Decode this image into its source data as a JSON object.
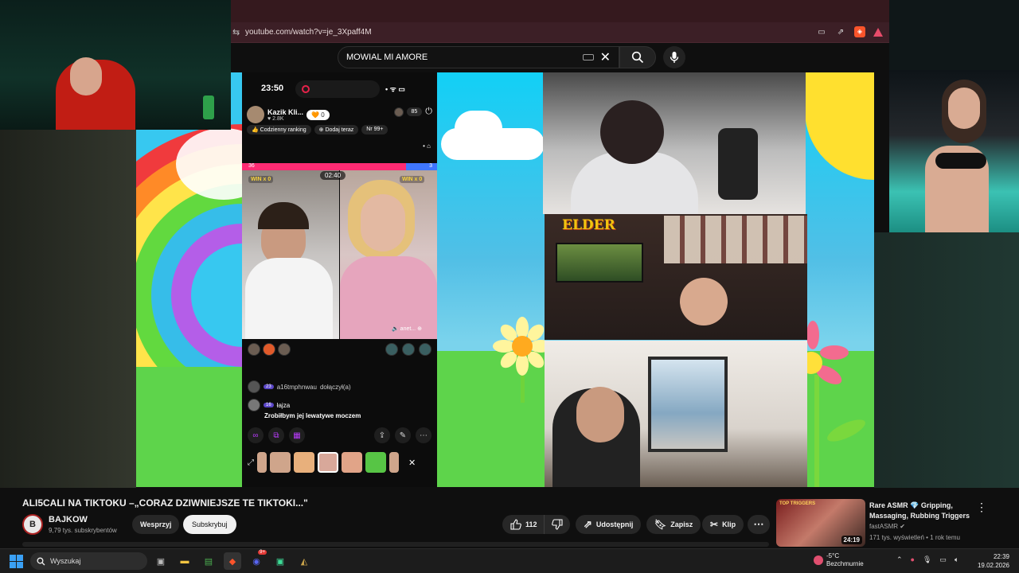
{
  "browser": {
    "url": "youtube.com/watch?v=je_3Xpaff4M"
  },
  "search": {
    "query": "MOWIAL MI AMORE"
  },
  "tiktok": {
    "time": "23:50",
    "streamer_name": "Kazik Kli...",
    "likes": "2.8K",
    "follow_count": "0",
    "viewers": "85",
    "daily_ranking": "Codzienny ranking",
    "add_now": "Dodaj teraz",
    "rank": "Nr 99+",
    "score_left": "36",
    "score_right": "3",
    "timer": "02:40",
    "win_left": "WIN x 0",
    "win_right": "WIN x 0",
    "anet": "anet...",
    "chat": [
      {
        "level": "23",
        "user": "a16tmphnwau",
        "text": "dołączył(a)"
      },
      {
        "level": "16",
        "user": "łajza",
        "text": "Zrobiłbym jej lewatywe moczem"
      }
    ]
  },
  "overlay": {
    "elder_logo": "ELDER"
  },
  "video": {
    "title": "ALI5CALI NA TIKTOKU –„CORAZ DZIWNIEJSZE TE TIKTOKI...\"",
    "channel": "BAJKOW",
    "channel_initial": "B",
    "subscribers": "9,79 tys. subskrybentów",
    "support_label": "Wesprzyj",
    "subscribe_label": "Subskrybuj",
    "likes": "112",
    "share_label": "Udostępnij",
    "save_label": "Zapisz",
    "clip_label": "Klip"
  },
  "recommendation": {
    "title": "Rare ASMR 💎 Gripping, Massaging, Rubbing Triggers",
    "channel": "fastASMR",
    "meta": "171 tys. wyświetleń • 1 rok temu",
    "duration": "24:19",
    "thumb_tag": "TOP TRIGGERS"
  },
  "taskbar": {
    "search_placeholder": "Wyszukaj",
    "discord_badge": "9+",
    "temperature": "-5°C",
    "weather": "Bezchmurnie",
    "time": "22:39",
    "date": "19.02.2026"
  }
}
